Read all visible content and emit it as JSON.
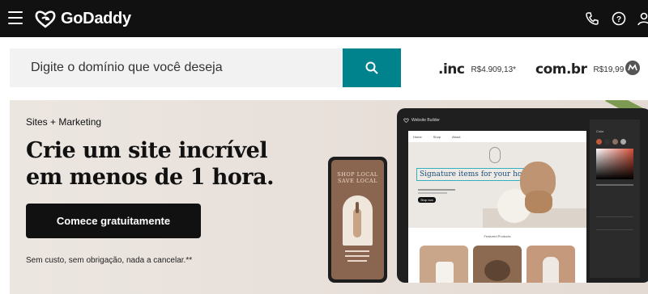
{
  "header": {
    "logo_text": "GoDaddy",
    "icons": [
      "menu-icon",
      "godaddy-logo-icon",
      "phone-icon",
      "help-icon",
      "user-icon"
    ]
  },
  "search": {
    "placeholder": "Digite o domínio que você deseja",
    "button_icon": "search-icon",
    "accent_color": "#00838c"
  },
  "tld_offers": [
    {
      "name": ".inc",
      "price": "R$4.909,13*"
    },
    {
      "name": "com.br",
      "price": "R$19,99"
    }
  ],
  "hero": {
    "eyebrow": "Sites + Marketing",
    "headline": "Crie um site incrível em menos de 1 hora.",
    "cta_label": "Comece gratuitamente",
    "disclaimer": "Sem custo, sem obrigação, nada a cancelar.**"
  },
  "mockup": {
    "phone_title": "SHOP LOCAL SAVE LOCAL",
    "tablet_app": "Website Builder",
    "site_headline": "Signature items for your home.",
    "site_cta": "Shop now",
    "featured_label": "Featured Products",
    "panel_label": "Color"
  }
}
